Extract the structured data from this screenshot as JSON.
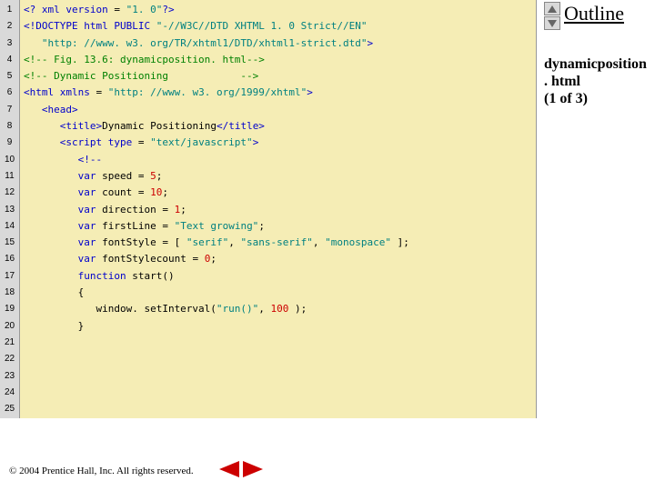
{
  "sidebar": {
    "outline": "Outline",
    "caption_l1": "dynamicposition",
    "caption_l2": ". html",
    "caption_l3": "(1 of 3)"
  },
  "footer": {
    "copyright": "© 2004 Prentice Hall, Inc.  All rights reserved."
  },
  "code": {
    "lines": [
      {
        "n": "1",
        "seg": [
          {
            "c": "blue",
            "t": "<? xml version "
          },
          {
            "c": "black",
            "t": "= "
          },
          {
            "c": "teal",
            "t": "\"1. 0\""
          },
          {
            "c": "blue",
            "t": "?>"
          }
        ]
      },
      {
        "n": "2",
        "seg": [
          {
            "c": "blue",
            "t": "<!DOCTYPE html PUBLIC"
          },
          {
            "c": "teal",
            "t": " \"-//W3C//DTD XHTML 1. 0 Strict//EN\""
          }
        ]
      },
      {
        "n": "3",
        "seg": [
          {
            "c": "black",
            "t": "   "
          },
          {
            "c": "teal",
            "t": "\"http: //www. w3. org/TR/xhtml1/DTD/xhtml1-strict.dtd\""
          },
          {
            "c": "blue",
            "t": ">"
          }
        ]
      },
      {
        "n": "4",
        "seg": [
          {
            "c": "black",
            "t": ""
          }
        ]
      },
      {
        "n": "5",
        "seg": [
          {
            "c": "green",
            "t": "<!-- Fig. 13.6: dynamicposition. html-->"
          }
        ]
      },
      {
        "n": "6",
        "seg": [
          {
            "c": "green",
            "t": "<!-- Dynamic Positioning            -->"
          }
        ]
      },
      {
        "n": "7",
        "seg": [
          {
            "c": "black",
            "t": ""
          }
        ]
      },
      {
        "n": "8",
        "seg": [
          {
            "c": "blue",
            "t": "<html xmlns "
          },
          {
            "c": "black",
            "t": "= "
          },
          {
            "c": "teal",
            "t": "\"http: //www. w3. org/1999/xhtml\""
          },
          {
            "c": "blue",
            "t": ">"
          }
        ]
      },
      {
        "n": "9",
        "seg": [
          {
            "c": "black",
            "t": "   "
          },
          {
            "c": "blue",
            "t": "<head>"
          }
        ]
      },
      {
        "n": "10",
        "seg": [
          {
            "c": "black",
            "t": "      "
          },
          {
            "c": "blue",
            "t": "<title>"
          },
          {
            "c": "black",
            "t": "Dynamic Positioning"
          },
          {
            "c": "blue",
            "t": "</title>"
          }
        ]
      },
      {
        "n": "11",
        "seg": [
          {
            "c": "black",
            "t": ""
          }
        ]
      },
      {
        "n": "12",
        "seg": [
          {
            "c": "black",
            "t": "      "
          },
          {
            "c": "blue",
            "t": "<script type "
          },
          {
            "c": "black",
            "t": "= "
          },
          {
            "c": "teal",
            "t": "\"text/javascript\""
          },
          {
            "c": "blue",
            "t": ">"
          }
        ]
      },
      {
        "n": "13",
        "seg": [
          {
            "c": "black",
            "t": "         "
          },
          {
            "c": "blue",
            "t": "<!--"
          }
        ]
      },
      {
        "n": "14",
        "seg": [
          {
            "c": "black",
            "t": "         "
          },
          {
            "c": "blue",
            "t": "var "
          },
          {
            "c": "black",
            "t": "speed = "
          },
          {
            "c": "red",
            "t": "5"
          },
          {
            "c": "black",
            "t": ";"
          }
        ]
      },
      {
        "n": "15",
        "seg": [
          {
            "c": "black",
            "t": "         "
          },
          {
            "c": "blue",
            "t": "var "
          },
          {
            "c": "black",
            "t": "count = "
          },
          {
            "c": "red",
            "t": "10"
          },
          {
            "c": "black",
            "t": ";"
          }
        ]
      },
      {
        "n": "16",
        "seg": [
          {
            "c": "black",
            "t": "         "
          },
          {
            "c": "blue",
            "t": "var "
          },
          {
            "c": "black",
            "t": "direction = "
          },
          {
            "c": "red",
            "t": "1"
          },
          {
            "c": "black",
            "t": ";"
          }
        ]
      },
      {
        "n": "17",
        "seg": [
          {
            "c": "black",
            "t": "         "
          },
          {
            "c": "blue",
            "t": "var "
          },
          {
            "c": "black",
            "t": "firstLine = "
          },
          {
            "c": "teal",
            "t": "\"Text growing\""
          },
          {
            "c": "black",
            "t": ";"
          }
        ]
      },
      {
        "n": "18",
        "seg": [
          {
            "c": "black",
            "t": "         "
          },
          {
            "c": "blue",
            "t": "var "
          },
          {
            "c": "black",
            "t": "fontStyle = [ "
          },
          {
            "c": "teal",
            "t": "\"serif\""
          },
          {
            "c": "black",
            "t": ", "
          },
          {
            "c": "teal",
            "t": "\"sans-serif\""
          },
          {
            "c": "black",
            "t": ", "
          },
          {
            "c": "teal",
            "t": "\"monospace\""
          },
          {
            "c": "black",
            "t": " ];"
          }
        ]
      },
      {
        "n": "19",
        "seg": [
          {
            "c": "black",
            "t": "         "
          },
          {
            "c": "blue",
            "t": "var "
          },
          {
            "c": "black",
            "t": "fontStylecount = "
          },
          {
            "c": "red",
            "t": "0"
          },
          {
            "c": "black",
            "t": ";"
          }
        ]
      },
      {
        "n": "20",
        "seg": [
          {
            "c": "black",
            "t": ""
          }
        ]
      },
      {
        "n": "21",
        "seg": [
          {
            "c": "black",
            "t": "         "
          },
          {
            "c": "blue",
            "t": "function "
          },
          {
            "c": "black",
            "t": "start()"
          }
        ]
      },
      {
        "n": "22",
        "seg": [
          {
            "c": "black",
            "t": "         {"
          }
        ]
      },
      {
        "n": "23",
        "seg": [
          {
            "c": "black",
            "t": "            window. setInterval("
          },
          {
            "c": "teal",
            "t": "\"run()\""
          },
          {
            "c": "black",
            "t": ", "
          },
          {
            "c": "red",
            "t": "100 "
          },
          {
            "c": "black",
            "t": ");"
          }
        ]
      },
      {
        "n": "24",
        "seg": [
          {
            "c": "black",
            "t": "         }"
          }
        ]
      },
      {
        "n": "25",
        "seg": [
          {
            "c": "black",
            "t": ""
          }
        ]
      }
    ]
  }
}
